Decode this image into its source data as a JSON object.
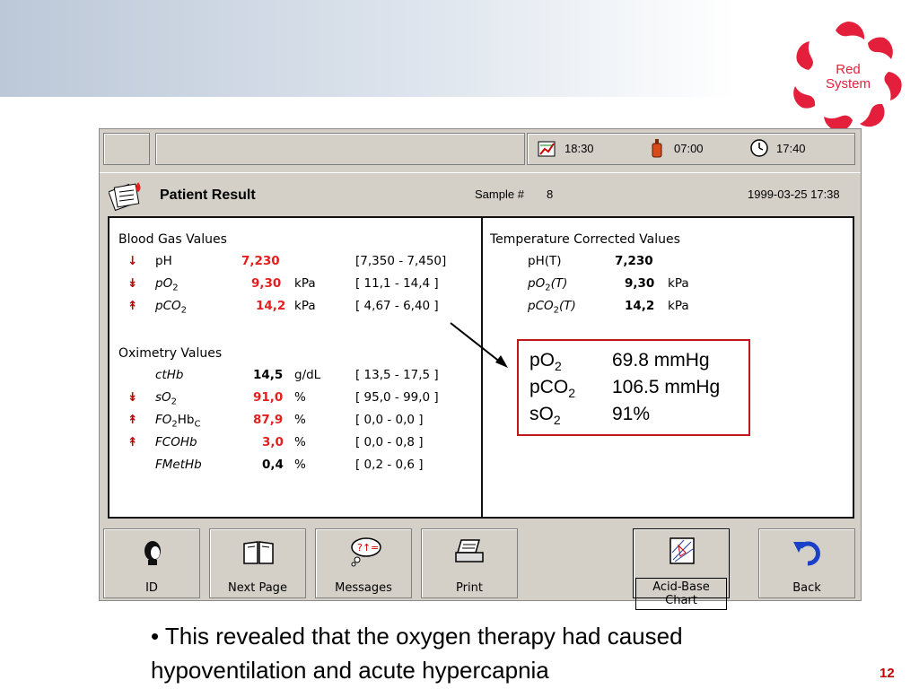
{
  "logo": {
    "line1": "Red",
    "line2": "System"
  },
  "status": {
    "time1": "18:30",
    "time2": "07:00",
    "time3": "17:40"
  },
  "header": {
    "title": "Patient Result",
    "sample_label": "Sample #",
    "sample_value": "8",
    "datetime": "1999-03-25 17:38"
  },
  "blood_gas": {
    "heading": "Blood Gas Values",
    "rows": [
      {
        "arrow": "↓",
        "name": "pH",
        "value": "7,230",
        "unit": "",
        "range": "[7,350 - 7,450]"
      },
      {
        "arrow": "↡",
        "name": "pO",
        "sub": "2",
        "value": "9,30",
        "unit": "kPa",
        "range": "[ 11,1 - 14,4 ]"
      },
      {
        "arrow": "↟",
        "name": "pCO",
        "sub": "2",
        "value": "14,2",
        "unit": "kPa",
        "range": "[ 4,67 - 6,40 ]"
      }
    ]
  },
  "oximetry": {
    "heading": "Oximetry Values",
    "rows": [
      {
        "arrow": "",
        "name": "ctHb",
        "value": "14,5",
        "unit": "g/dL",
        "range": "[ 13,5 - 17,5 ]",
        "red": false
      },
      {
        "arrow": "↡",
        "name": "sO",
        "sub": "2",
        "value": "91,0",
        "unit": "%",
        "range": "[ 95,0 - 99,0 ]",
        "red": true
      },
      {
        "arrow": "↟",
        "name": "FO",
        "sub": "2",
        "name2": "Hb",
        "sub2": "C",
        "value": "87,9",
        "unit": "%",
        "range": "[ 0,0 - 0,0 ]",
        "red": true
      },
      {
        "arrow": "↟",
        "name": "FCOHb",
        "value": "3,0",
        "unit": "%",
        "range": "[ 0,0 - 0,8 ]",
        "red": true
      },
      {
        "arrow": "",
        "name": "FMetHb",
        "value": "0,4",
        "unit": "%",
        "range": "[ 0,2 - 0,6 ]",
        "red": false
      }
    ]
  },
  "temp_corrected": {
    "heading": "Temperature Corrected Values",
    "rows": [
      {
        "name": "pH(T)",
        "value": "7,230",
        "unit": ""
      },
      {
        "name": "pO",
        "sub": "2",
        "suffix": "(T)",
        "value": "9,30",
        "unit": "kPa"
      },
      {
        "name": "pCO",
        "sub": "2",
        "suffix": "(T)",
        "value": "14,2",
        "unit": "kPa"
      }
    ]
  },
  "callout": {
    "rows": [
      {
        "label": "pO",
        "sub": "2",
        "value": "69.8 mmHg"
      },
      {
        "label": "pCO",
        "sub": "2",
        "value": "106.5 mmHg"
      },
      {
        "label": "sO",
        "sub": "2",
        "value": "91%"
      }
    ]
  },
  "buttons": {
    "id": "ID",
    "next_page": "Next Page",
    "messages": "Messages",
    "print": "Print",
    "acid_base": "Acid-Base Chart",
    "back": "Back"
  },
  "bullet": "• This revealed that the oxygen therapy had caused hypoventilation and acute hypercapnia",
  "page_number": "12",
  "colors": {
    "accent_red": "#e41f1f",
    "callout_border": "#c0161e",
    "panel_gray": "#d4d0c8"
  }
}
